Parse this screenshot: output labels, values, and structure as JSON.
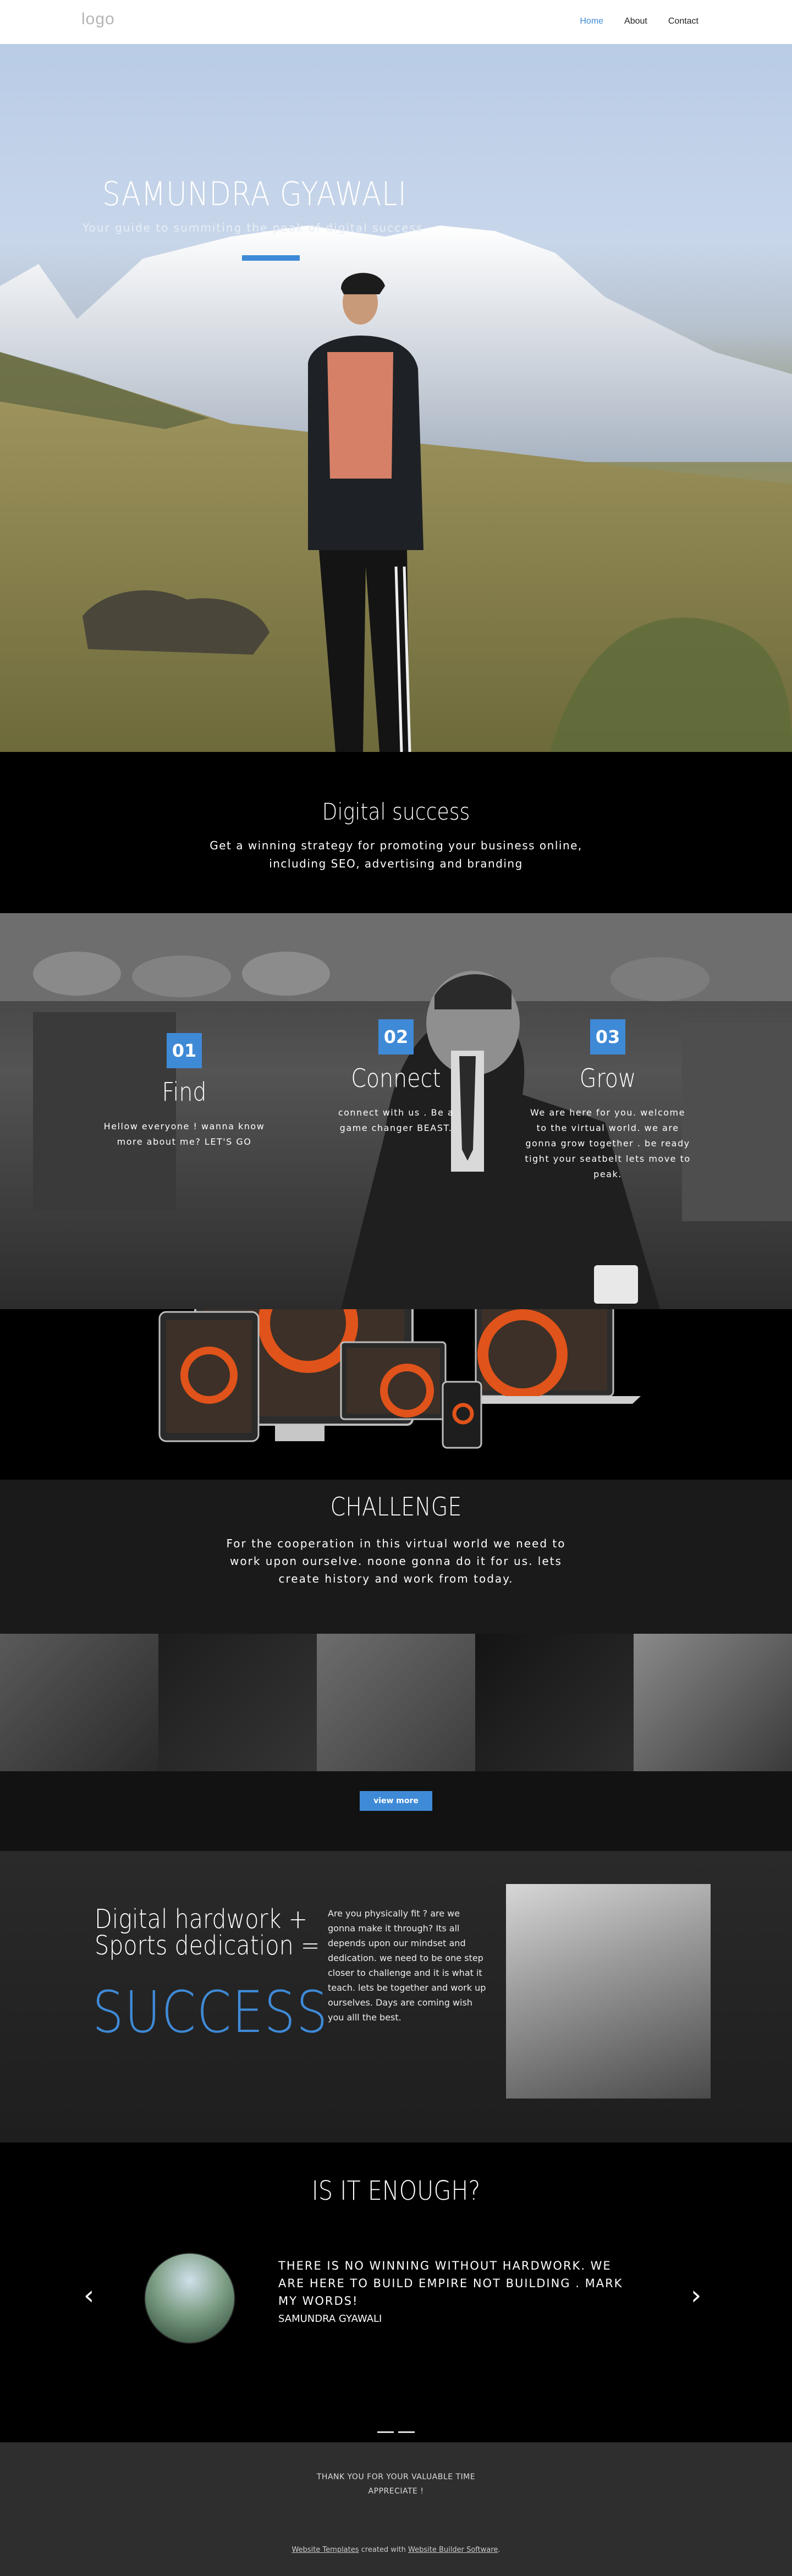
{
  "header": {
    "logo": "logo",
    "nav": [
      {
        "label": "Home",
        "active": true
      },
      {
        "label": "About",
        "active": false
      },
      {
        "label": "Contact",
        "active": false
      }
    ]
  },
  "hero": {
    "title": "SAMUNDRA GYAWALI",
    "subtitle": "Your guide to summiting the peak of digital success"
  },
  "digital": {
    "title": "Digital success",
    "text": "Get a winning strategy for promoting your business online, including SEO, advertising and branding"
  },
  "steps": [
    {
      "num": "01",
      "title": "Find",
      "text": "Hellow everyone ! wanna know more about me? LET'S GO"
    },
    {
      "num": "02",
      "title": "Connect",
      "text": "connect with us . Be a game changer BEAST."
    },
    {
      "num": "03",
      "title": "Grow",
      "text": "We are here for you. welcome to the virtual world. we are gonna grow together . be ready tight your seatbelt lets move to peak."
    }
  ],
  "challenge": {
    "title": "CHALLENGE",
    "text": "For the cooperation in this virtual world we need to work upon ourselve. noone gonna do it for us. lets create history and work from today."
  },
  "viewmore": {
    "label": "view more"
  },
  "hardwork": {
    "title": "Digital hardwork + Sports dedication =",
    "success": "SUCCESS",
    "text": "Are you physically fit ? are we gonna make it through? Its all depends upon our mindset and dedication. we need to be one step closer to challenge and it is what it teach. lets be together and work up ourselves. Days are coming wish you alll the best."
  },
  "quote": {
    "title": "IS IT ENOUGH?",
    "text": "THERE IS NO WINNING WITHOUT HARDWORK. WE ARE HERE TO BUILD EMPIRE NOT BUILDING . MARK MY WORDS!",
    "author": "SAMUNDRA GYAWALI",
    "prev": "‹",
    "next": "›"
  },
  "footer": {
    "thanks_line1": "THANK YOU FOR YOUR VALUABLE TIME",
    "thanks_line2": "APPRECIATE !",
    "credit_link1": "Website Templates",
    "credit_middle": " created with ",
    "credit_link2": "Website Builder Software",
    "credit_end": "."
  },
  "colors": {
    "accent": "#3f8ad7",
    "orange": "#e0531a"
  }
}
